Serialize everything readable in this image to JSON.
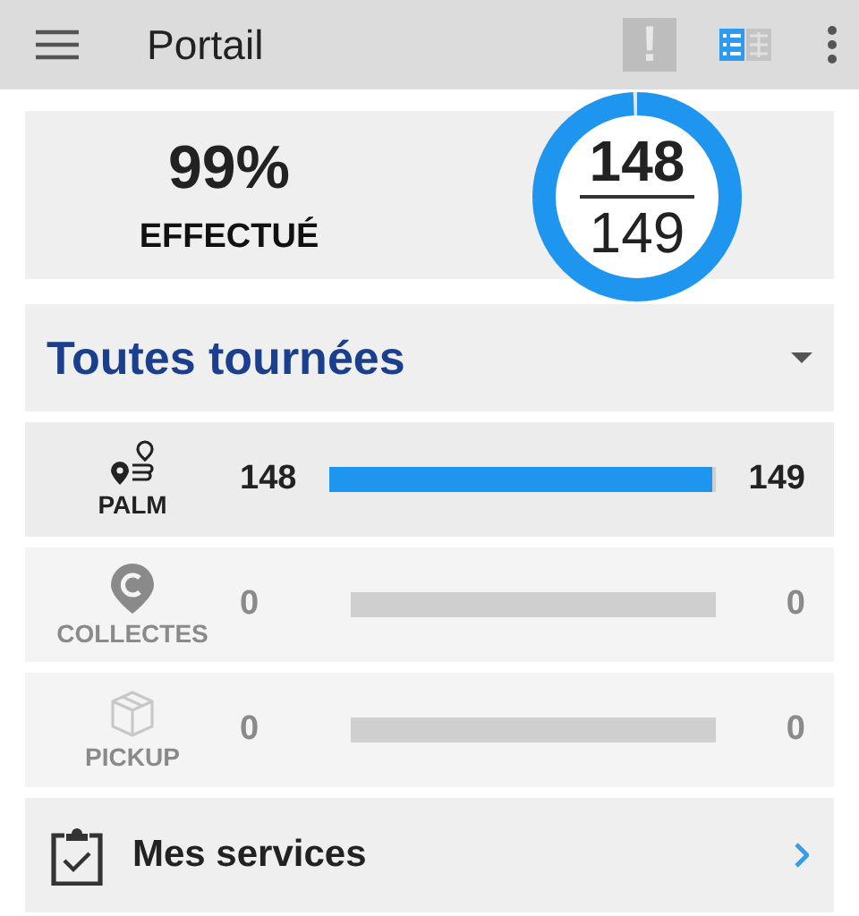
{
  "app_bar": {
    "title": "Portail",
    "alert_icon_text": "!",
    "view_toggle": {
      "list_selected": true
    }
  },
  "summary": {
    "percent": "99%",
    "label": "EFFECTUÉ",
    "done": "148",
    "total": "149",
    "level": 0.993
  },
  "filter": {
    "label": "Toutes tournées"
  },
  "rows": [
    {
      "kind": "route",
      "label": "PALM",
      "active": true,
      "done": "148",
      "total": "149",
      "level": 0.993
    },
    {
      "kind": "collect",
      "label": "COLLECTES",
      "active": false,
      "done": "0",
      "total": "0"
    },
    {
      "kind": "pickup",
      "label": "PICKUP",
      "active": false,
      "done": "0",
      "total": "0"
    }
  ],
  "services": {
    "label": "Mes services"
  }
}
